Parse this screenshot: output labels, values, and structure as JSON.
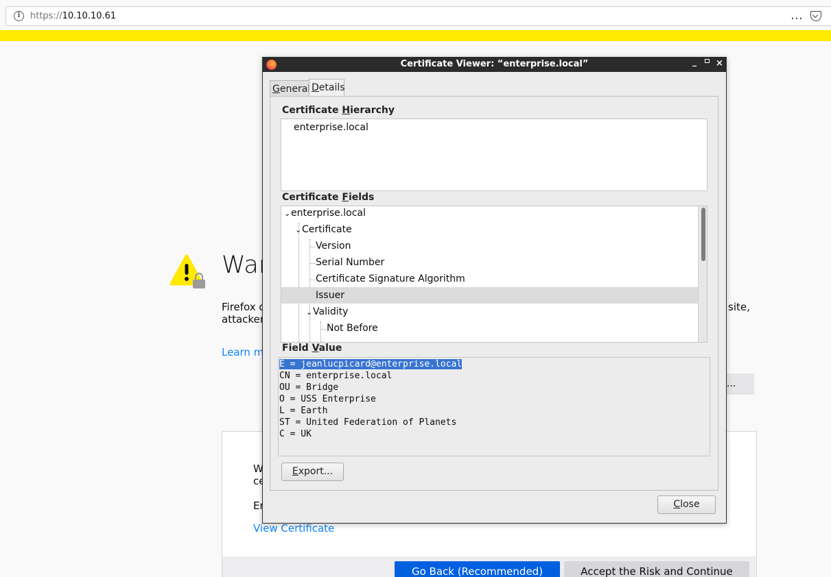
{
  "browser": {
    "url_scheme": "https://",
    "url_host": "10.10.10.61",
    "more_icon": "…",
    "info_icon": "i",
    "accent_strip": "#ffe900"
  },
  "error_page": {
    "title_partial": "War",
    "desc_line1_partial": "Firefox d",
    "desc_line2_partial": "attacker",
    "desc_right_partial": "site,",
    "learn_more_partial": "Learn m",
    "advanced_partial": "...",
    "adv_text1_partial": "W",
    "adv_text2_partial": "ce",
    "adv_text3_partial": "Er",
    "view_certificate": "View Certificate",
    "go_back": "Go Back (Recommended)",
    "accept": "Accept the Risk and Continue",
    "link_color": "#0a84ff",
    "primary_color": "#0060df"
  },
  "dialog": {
    "title": "Certificate Viewer: “enterprise.local”",
    "controls": {
      "minimize": "_",
      "close": "×"
    },
    "tabs": [
      {
        "label_pre": "",
        "label_ul": "G",
        "label_post": "eneral"
      },
      {
        "label_pre": "",
        "label_ul": "D",
        "label_post": "etails"
      }
    ],
    "hierarchy_label": {
      "pre": "Certificate ",
      "ul": "H",
      "post": "ierarchy"
    },
    "hierarchy_items": [
      "enterprise.local"
    ],
    "fields_label": {
      "pre": "Certificate ",
      "ul": "F",
      "post": "ields"
    },
    "fields_tree": [
      {
        "label": "enterprise.local",
        "expanded": true
      },
      {
        "label": "Certificate",
        "expanded": true
      },
      {
        "label": "Version"
      },
      {
        "label": "Serial Number"
      },
      {
        "label": "Certificate Signature Algorithm"
      },
      {
        "label": "Issuer",
        "selected": true
      },
      {
        "label": "Validity",
        "expanded": true
      },
      {
        "label": "Not Before"
      }
    ],
    "value_label": {
      "pre": "Field ",
      "ul": "V",
      "post": "alue"
    },
    "field_value_lines": [
      "E = jeanlucpicard@enterprise.local",
      "CN = enterprise.local",
      "OU = Bridge",
      "O = USS Enterprise",
      "L = Earth",
      "ST = United Federation of Planets",
      "C = UK"
    ],
    "export_button": {
      "ul": "E",
      "post": "xport..."
    },
    "close_button": {
      "ul": "C",
      "post": "lose"
    }
  }
}
